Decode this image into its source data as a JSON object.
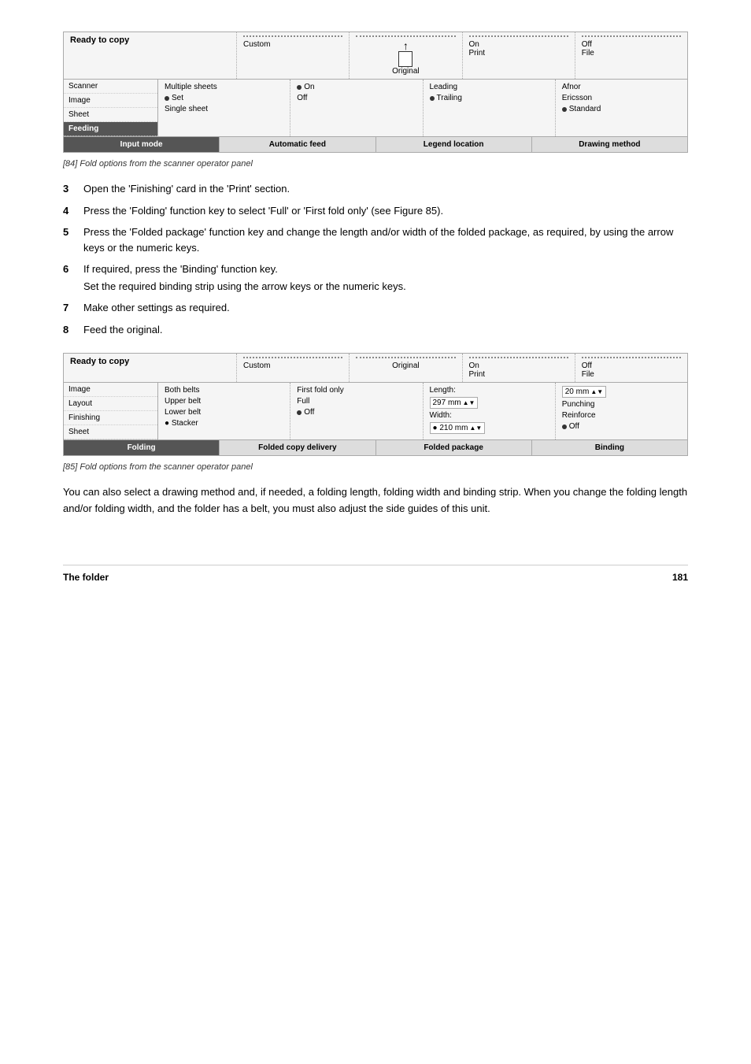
{
  "page": {
    "footer_left": "The folder",
    "footer_right": "181"
  },
  "figure84": {
    "caption": "[84] Fold options from the scanner operator panel",
    "panel": {
      "title": "Ready to copy",
      "top_sections": [
        {
          "label": "",
          "dotted": true
        },
        {
          "label": "On\nPrint"
        },
        {
          "label": "Off\nFile"
        }
      ],
      "custom_label": "Custom",
      "original_label": "Original",
      "sidebar_items": [
        {
          "label": "Scanner",
          "active": false
        },
        {
          "label": "Image",
          "active": false
        },
        {
          "label": "Sheet",
          "active": false
        },
        {
          "label": "Feeding",
          "active": true
        }
      ],
      "col1": {
        "items": [
          {
            "bullet": false,
            "text": "Multiple sheets"
          },
          {
            "bullet": true,
            "text": "Set"
          },
          {
            "bullet": false,
            "text": "Single sheet"
          }
        ]
      },
      "col2": {
        "items": [
          {
            "bullet": true,
            "text": "On"
          },
          {
            "bullet": false,
            "text": "Off"
          }
        ]
      },
      "col3": {
        "items": [
          {
            "bullet": false,
            "text": "Leading"
          },
          {
            "bullet": true,
            "text": "Trailing"
          }
        ]
      },
      "col4": {
        "items": [
          {
            "bullet": false,
            "text": "Afnor"
          },
          {
            "bullet": false,
            "text": "Ericsson"
          },
          {
            "bullet": true,
            "text": "Standard"
          }
        ]
      },
      "tabs": [
        {
          "label": "Input mode",
          "active": true
        },
        {
          "label": "Automatic feed",
          "active": false
        },
        {
          "label": "Legend location",
          "active": false
        },
        {
          "label": "Drawing method",
          "active": false
        }
      ]
    }
  },
  "steps": [
    {
      "num": "3",
      "text": "Open the 'Finishing' card in the 'Print' section."
    },
    {
      "num": "4",
      "text": "Press the 'Folding' function key to select 'Full' or 'First fold only' (see Figure 85)."
    },
    {
      "num": "5",
      "text": "Press the 'Folded package' function key and change the length and/or width of the folded package, as required, by using the arrow keys or the numeric keys."
    },
    {
      "num": "6",
      "text": "If required, press the 'Binding' function key.",
      "sub": "Set the required binding strip using the arrow keys or the numeric keys."
    },
    {
      "num": "7",
      "text": "Make other settings as required."
    },
    {
      "num": "8",
      "text": "Feed the original."
    }
  ],
  "figure85": {
    "caption": "[85] Fold options from the scanner operator panel",
    "panel": {
      "title": "Ready to copy",
      "top_sections": [
        {
          "label": "",
          "dotted": true
        },
        {
          "label": "On\nPrint"
        },
        {
          "label": "Off\nFile"
        }
      ],
      "custom_label": "Custom",
      "original_label": "Original",
      "sidebar_items": [
        {
          "label": "Image",
          "active": false
        },
        {
          "label": "Layout",
          "active": false
        },
        {
          "label": "Finishing",
          "active": false
        },
        {
          "label": "Sheet",
          "active": false
        }
      ],
      "col1": {
        "items": [
          {
            "bullet": false,
            "text": "Both belts"
          },
          {
            "bullet": false,
            "text": "Upper belt"
          },
          {
            "bullet": false,
            "text": "Lower belt"
          },
          {
            "bullet": false,
            "text": "Stacker"
          }
        ]
      },
      "col2_label": "First fold only",
      "col2_items": [
        {
          "bullet": false,
          "text": "Full"
        },
        {
          "bullet": true,
          "text": "Off"
        }
      ],
      "col3": {
        "label": "Length:",
        "val1": "297 mm",
        "label2": "Width:",
        "val2": "210 mm"
      },
      "col4": {
        "items": [
          {
            "bullet": false,
            "text": "20 mm",
            "spinbox": true
          },
          {
            "bullet": false,
            "text": "Punching"
          },
          {
            "bullet": false,
            "text": "Reinforce"
          },
          {
            "bullet": true,
            "text": "Off"
          }
        ]
      },
      "tabs": [
        {
          "label": "Folding",
          "active": true
        },
        {
          "label": "Folded copy delivery",
          "active": false
        },
        {
          "label": "Folded package",
          "active": false
        },
        {
          "label": "Binding",
          "active": false
        }
      ]
    }
  },
  "body_text": "You can also select a drawing method and, if needed, a folding length, folding width and binding strip. When you change the folding length and/or folding width, and the folder has a belt, you must also adjust the side guides of this unit."
}
